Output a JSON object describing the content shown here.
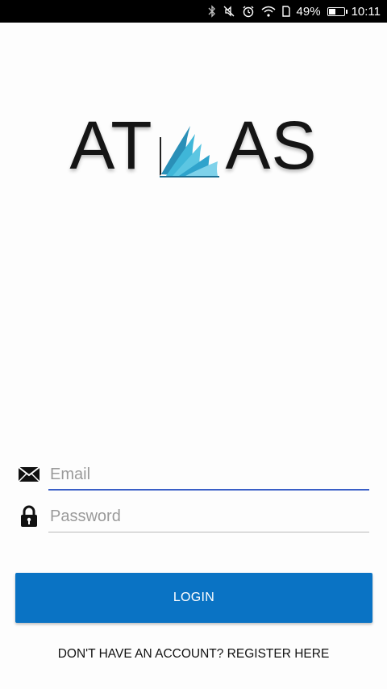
{
  "status_bar": {
    "battery_percent": "49%",
    "time": "10:11",
    "battery_level": 0.49,
    "icons": [
      "bluetooth-icon",
      "mute-icon",
      "alarm-icon",
      "wifi-icon",
      "sim-icon",
      "battery-icon"
    ]
  },
  "logo": {
    "left_text": "AT",
    "right_text": "AS",
    "book_color": "#3fb6d8"
  },
  "login_form": {
    "email_placeholder": "Email",
    "password_placeholder": "Password",
    "login_label": "LOGIN",
    "register_label": "DON'T HAVE AN ACCOUNT? REGISTER HERE"
  },
  "colors": {
    "primary": "#0a73c4",
    "email_underline": "#3a5fc7"
  }
}
